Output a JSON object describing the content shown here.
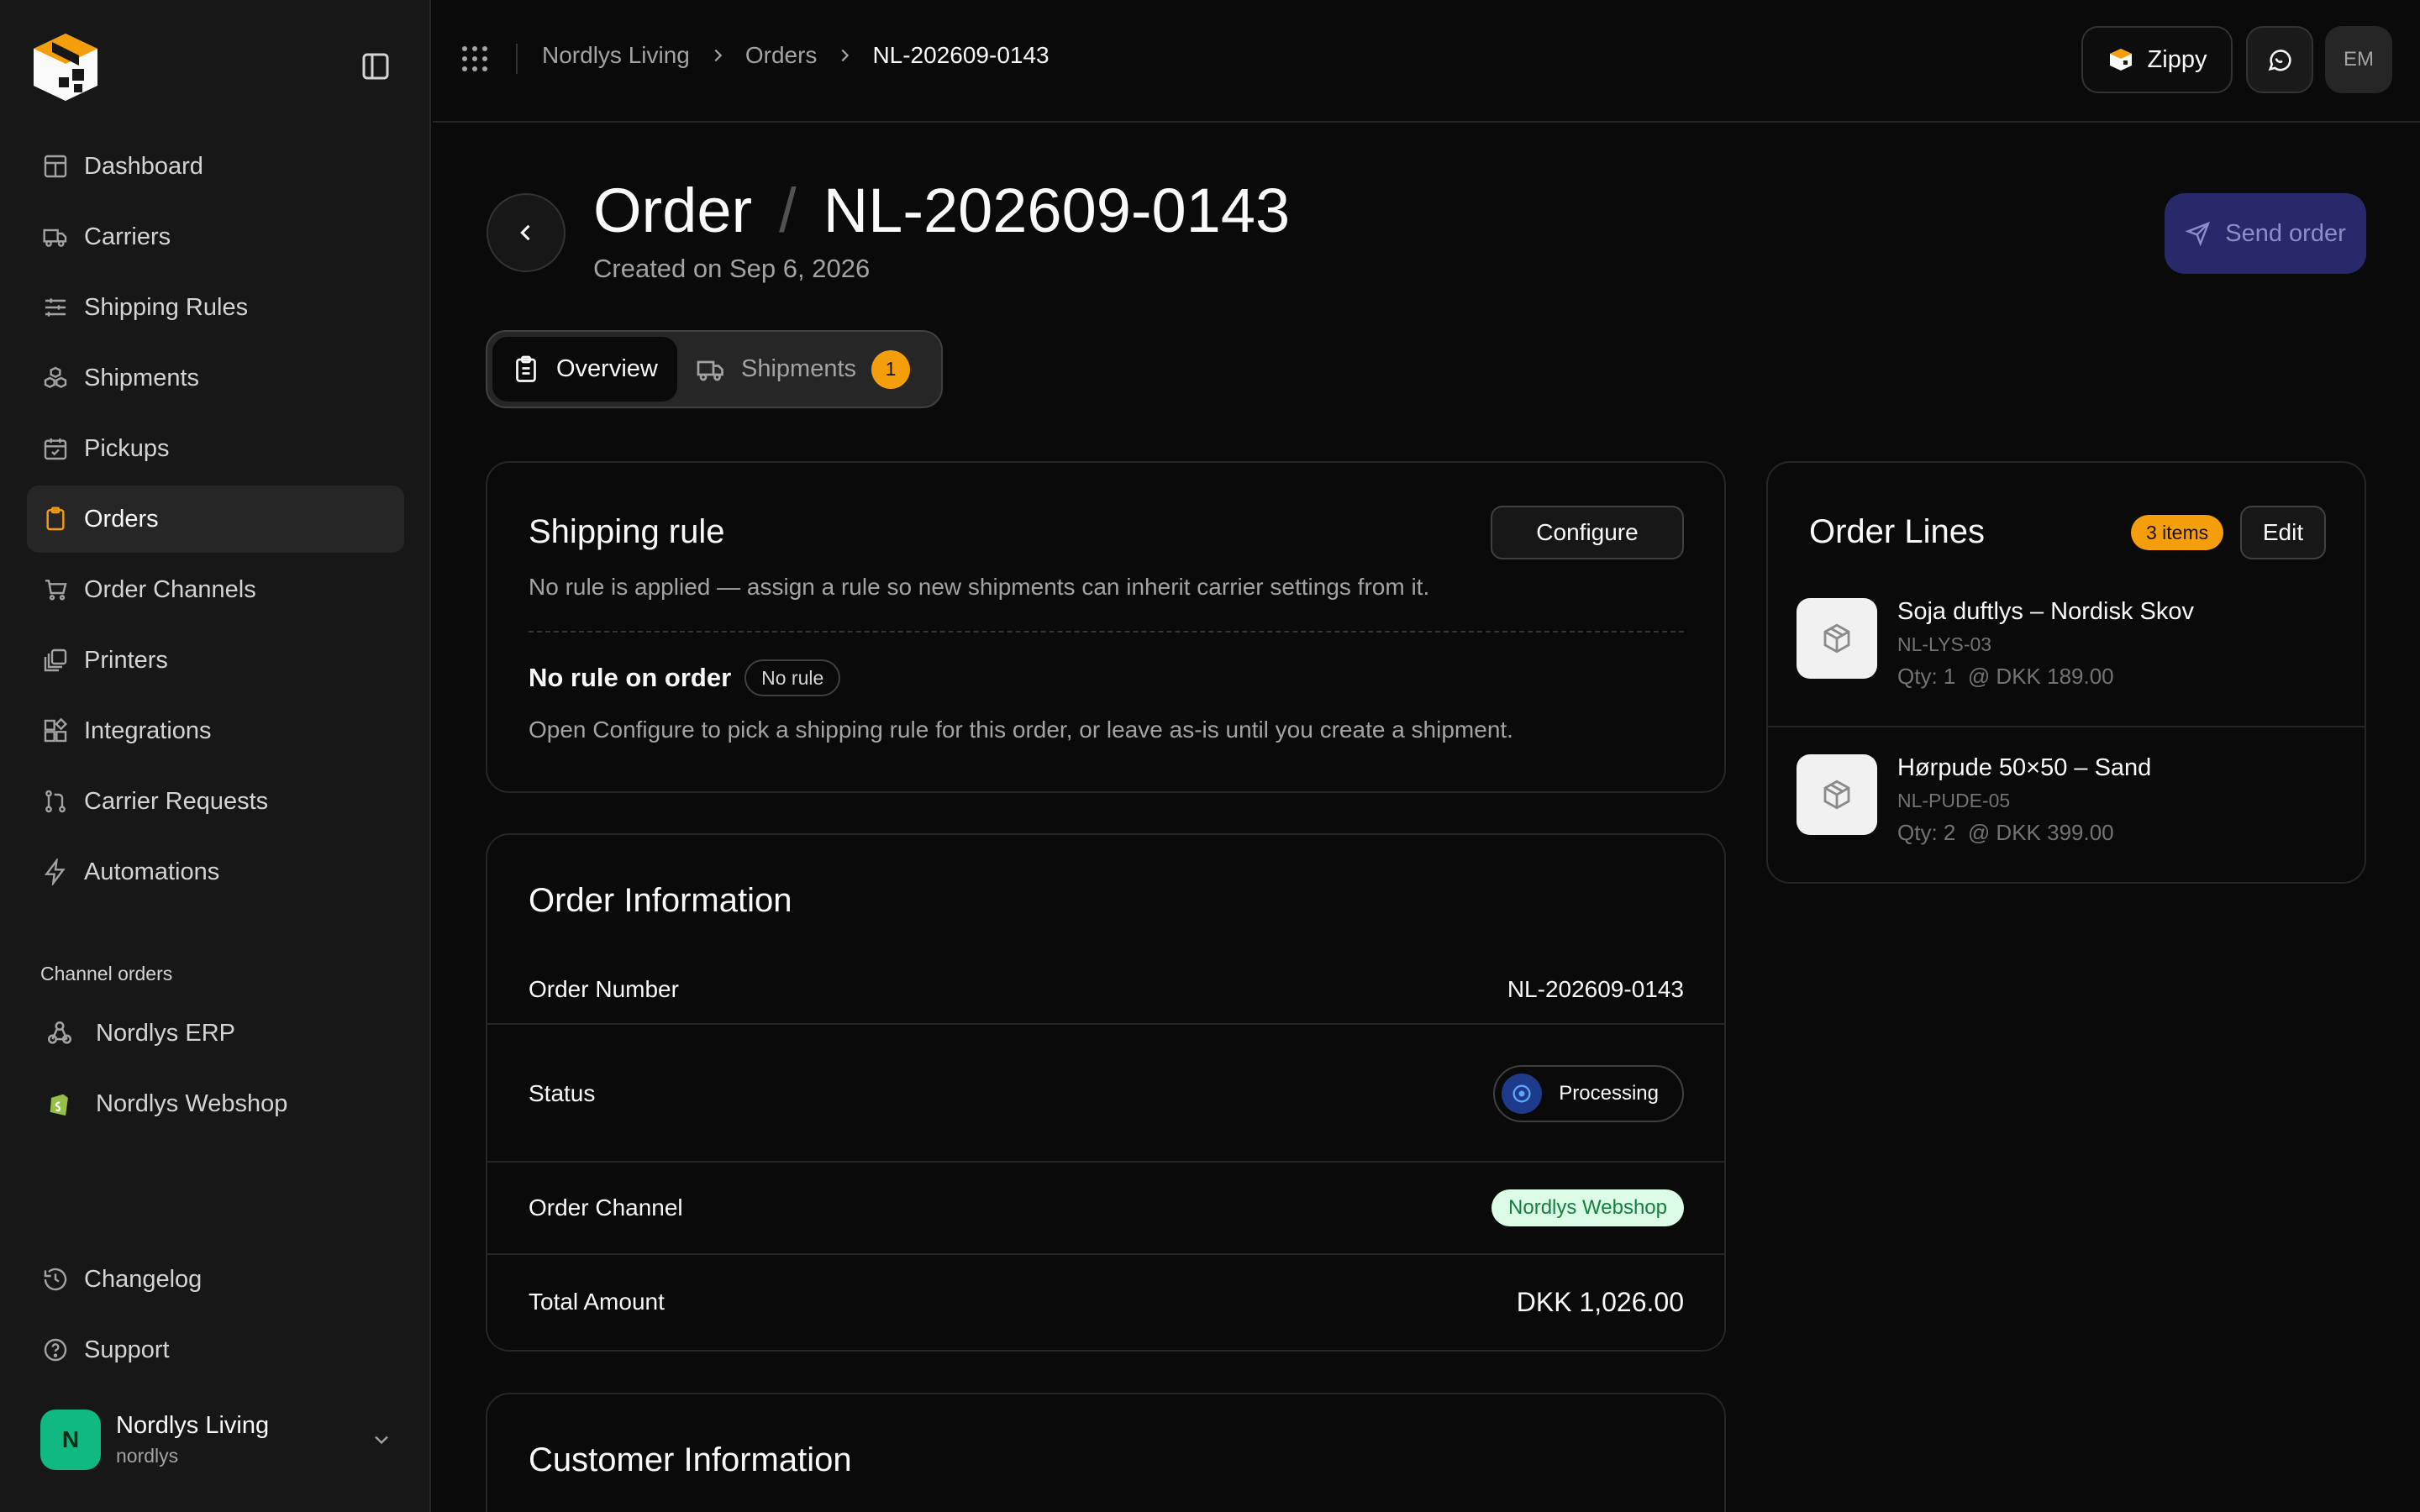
{
  "app": {
    "brand": "Zippy"
  },
  "sidebar": {
    "nav": [
      {
        "label": "Dashboard",
        "icon": "dashboard-icon"
      },
      {
        "label": "Carriers",
        "icon": "truck-icon"
      },
      {
        "label": "Shipping Rules",
        "icon": "sliders-icon"
      },
      {
        "label": "Shipments",
        "icon": "boxes-icon"
      },
      {
        "label": "Pickups",
        "icon": "calendar-check-icon"
      },
      {
        "label": "Orders",
        "icon": "clipboard-icon",
        "active": true
      },
      {
        "label": "Order Channels",
        "icon": "cart-icon"
      },
      {
        "label": "Printers",
        "icon": "printer-icon"
      },
      {
        "label": "Integrations",
        "icon": "integrations-icon"
      },
      {
        "label": "Carrier Requests",
        "icon": "git-pull-request-icon"
      },
      {
        "label": "Automations",
        "icon": "bolt-icon"
      }
    ],
    "channel_section_label": "Channel orders",
    "channels": [
      {
        "label": "Nordlys ERP",
        "icon": "webhook-icon"
      },
      {
        "label": "Nordlys Webshop",
        "icon": "shopify-icon"
      }
    ],
    "bottom": [
      {
        "label": "Changelog",
        "icon": "history-icon"
      },
      {
        "label": "Support",
        "icon": "help-circle-icon"
      }
    ],
    "account": {
      "initial": "N",
      "name": "Nordlys Living",
      "handle": "nordlys"
    }
  },
  "topbar": {
    "breadcrumb": [
      "Nordlys Living",
      "Orders",
      "NL-202609-0143"
    ],
    "brand_button": "Zippy",
    "user_initials": "EM"
  },
  "header": {
    "title_prefix": "Order",
    "title_id": "NL-202609-0143",
    "subtitle": "Created on Sep 6, 2026",
    "send_button": "Send order"
  },
  "tabs": [
    {
      "label": "Overview",
      "active": true
    },
    {
      "label": "Shipments",
      "badge": "1"
    }
  ],
  "shipping_rule": {
    "title": "Shipping rule",
    "configure_button": "Configure",
    "description": "No rule is applied — assign a rule so new shipments can inherit carrier settings from it.",
    "rule_name": "No rule on order",
    "rule_badge": "No rule",
    "help": "Open Configure to pick a shipping rule for this order, or leave as-is until you create a shipment."
  },
  "order_info": {
    "title": "Order Information",
    "rows": [
      {
        "label": "Order Number",
        "value": "NL-202609-0143"
      },
      {
        "label": "Status",
        "value": "Processing"
      },
      {
        "label": "Order Channel",
        "value": "Nordlys Webshop"
      },
      {
        "label": "Total Amount",
        "value": "DKK 1,026.00"
      }
    ]
  },
  "customer_info": {
    "title": "Customer Information"
  },
  "order_lines": {
    "title": "Order Lines",
    "count_badge": "3 items",
    "edit_button": "Edit",
    "items": [
      {
        "name": "Soja duftlys – Nordisk Skov",
        "sku": "NL-LYS-03",
        "qty": "Qty: 1",
        "price": "@ DKK 189.00"
      },
      {
        "name": "Hørpude 50×50 – Sand",
        "sku": "NL-PUDE-05",
        "qty": "Qty: 2",
        "price": "@ DKK 399.00"
      }
    ]
  },
  "colors": {
    "accent": "#f59e0b",
    "primary_button": "#27296b",
    "status_processing": "#1e3a8a",
    "channel_pill_bg": "#dcfce7",
    "channel_pill_text": "#15803d",
    "account_avatar": "#10b981"
  }
}
